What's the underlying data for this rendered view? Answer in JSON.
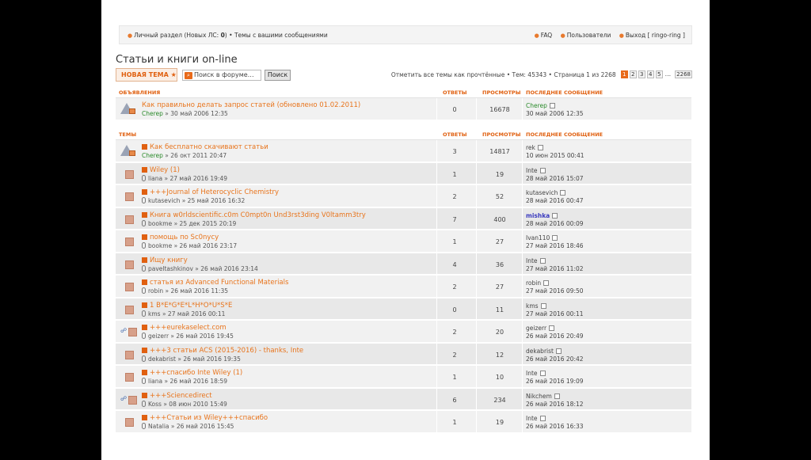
{
  "topbar": {
    "left_text": "Личный раздел (Новых ЛС: ",
    "left_count": "0",
    "left_close": ")",
    "left_sep": " • ",
    "left_link2": "Темы с вашими сообщениями",
    "faq": "FAQ",
    "users": "Пользователи",
    "logout": "Выход [ ringo-ring ]"
  },
  "page_title": "Статьи и книги on-line",
  "new_topic": "НОВАЯ ТЕМА ★",
  "search": {
    "placeholder": "Поиск в форуме…",
    "button": "Поиск"
  },
  "pagination": {
    "summary": "Отметить все темы как прочтённые • Тем: 45343 • Страница 1 из 2268",
    "pages": [
      "1",
      "2",
      "3",
      "4",
      "5"
    ],
    "current": "1",
    "dots": "…",
    "last": "2268"
  },
  "announcements": {
    "header": {
      "col_title": "ОБЪЯВЛЕНИЯ",
      "col_replies": "ОТВЕТЫ",
      "col_views": "ПРОСМОТРЫ",
      "col_last": "ПОСЛЕДНЕЕ СООБЩЕНИЕ"
    },
    "rows": [
      {
        "title": "Как правильно делать запрос статей (обновлено 01.02.2011)",
        "author": "Cherep",
        "date": "30 май 2006 12:35",
        "replies": "0",
        "views": "16678",
        "last_author": "Cherep",
        "last_date": "30 май 2006 12:35"
      }
    ]
  },
  "topics": {
    "header": {
      "col_title": "ТЕМЫ",
      "col_replies": "ОТВЕТЫ",
      "col_views": "ПРОСМОТРЫ",
      "col_last": "ПОСЛЕДНЕЕ СООБЩЕНИЕ"
    },
    "rows": [
      {
        "title": "Как бесплатно скачивают статьи",
        "author": "Cherep",
        "date": "26 окт 2011 20:47",
        "replies": "3",
        "views": "14817",
        "last_author": "rek",
        "last_date": "10 июн 2015 00:41"
      },
      {
        "title": "Wiley (1)",
        "author": "liana",
        "date": "27 май 2016 19:49",
        "replies": "1",
        "views": "19",
        "last_author": "Inte",
        "last_date": "28 май 2016 15:07"
      },
      {
        "title": "+++Journal of Heterocyclic Chemistry",
        "author": "kutasevich",
        "date": "25 май 2016 16:32",
        "replies": "2",
        "views": "52",
        "last_author": "kutasevich",
        "last_date": "28 май 2016 00:47"
      },
      {
        "title": "Книга w0rldscientific.c0m C0mpt0n Und3rst3ding V0ltamm3try",
        "author": "bookme",
        "date": "25 дек 2015 20:19",
        "replies": "7",
        "views": "400",
        "last_author": "mishka",
        "last_date": "28 май 2016 00:09"
      },
      {
        "title": "помощь по Sc0nycy",
        "author": "bookme",
        "date": "26 май 2016 23:17",
        "replies": "1",
        "views": "27",
        "last_author": "Ivan110",
        "last_date": "27 май 2016 18:46"
      },
      {
        "title": "Ищу книгу",
        "author": "paveltashkinov",
        "date": "26 май 2016 23:14",
        "replies": "4",
        "views": "36",
        "last_author": "Inte",
        "last_date": "27 май 2016 11:02"
      },
      {
        "title": "статья из Advanced Functional Materials",
        "author": "robin",
        "date": "26 май 2016 11:35",
        "replies": "2",
        "views": "27",
        "last_author": "robin",
        "last_date": "27 май 2016 09:50"
      },
      {
        "title": "1 B*E*G*E*L*H*O*U*S*E",
        "author": "kms",
        "date": "27 май 2016 00:11",
        "replies": "0",
        "views": "11",
        "last_author": "kms",
        "last_date": "27 май 2016 00:11"
      },
      {
        "title": "+++eurekaselect.com",
        "author": "geizerr",
        "date": "26 май 2016 19:45",
        "replies": "2",
        "views": "20",
        "last_author": "geizerr",
        "last_date": "26 май 2016 20:49"
      },
      {
        "title": "+++3 статьи ACS (2015-2016) - thanks, Inte",
        "author": "dekabrist",
        "date": "26 май 2016 19:35",
        "replies": "2",
        "views": "12",
        "last_author": "dekabrist",
        "last_date": "26 май 2016 20:42"
      },
      {
        "title": "+++спасибо Inte Wiley (1)",
        "author": "liana",
        "date": "26 май 2016 18:59",
        "replies": "1",
        "views": "10",
        "last_author": "Inte",
        "last_date": "26 май 2016 19:09"
      },
      {
        "title": "+++Sciencedirect",
        "author": "Koss",
        "date": "08 июн 2010 15:49",
        "replies": "6",
        "views": "234",
        "last_author": "Nikchem",
        "last_date": "26 май 2016 18:12"
      },
      {
        "title": "+++Статьи из Wiley+++спасибо",
        "author": "Natalia",
        "date": "26 май 2016 15:45",
        "replies": "1",
        "views": "19",
        "last_author": "Inte",
        "last_date": "26 май 2016 16:33"
      }
    ]
  },
  "colors": {
    "accent": "#e8741c",
    "header_orange": "#e06010",
    "green_user": "#2a8a2a",
    "blue_user": "#3b3bbf"
  }
}
